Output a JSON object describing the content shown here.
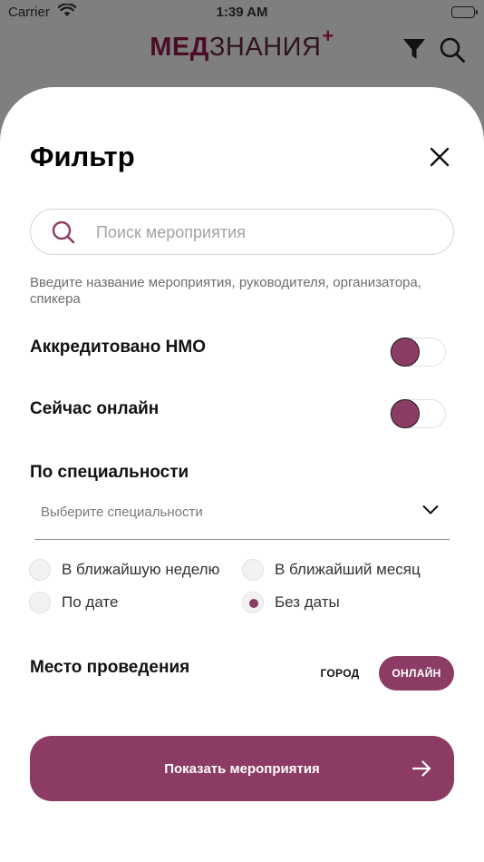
{
  "status_bar": {
    "carrier": "Carrier",
    "time": "1:39 AM"
  },
  "app_header": {
    "logo_bold": "МЕД",
    "logo_light": "ЗНАНИЯ",
    "logo_plus": "+"
  },
  "filter": {
    "title": "Фильтр",
    "search": {
      "placeholder": "Поиск мероприятия",
      "value": "",
      "hint": "Введите название мероприятия, руководителя, организатора, спикера"
    },
    "toggles": [
      {
        "label": "Аккредитовано НМО",
        "on": false
      },
      {
        "label": "Сейчас онлайн",
        "on": false
      }
    ],
    "specialty": {
      "label": "По специальности",
      "placeholder": "Выберите специальности"
    },
    "date_options": [
      {
        "label": "В ближайшую неделю",
        "selected": false
      },
      {
        "label": "В ближайший месяц",
        "selected": false
      },
      {
        "label": "По дате",
        "selected": false
      },
      {
        "label": "Без даты",
        "selected": true
      }
    ],
    "venue": {
      "label": "Место проведения",
      "city": "ГОРОД",
      "online": "ОНЛАЙН",
      "selected": "online"
    },
    "submit_label": "Показать мероприятия"
  },
  "colors": {
    "accent": "#8c3c64",
    "overlay": "#7f7f7f",
    "text": "#111111",
    "hint": "#6e6e6e"
  }
}
